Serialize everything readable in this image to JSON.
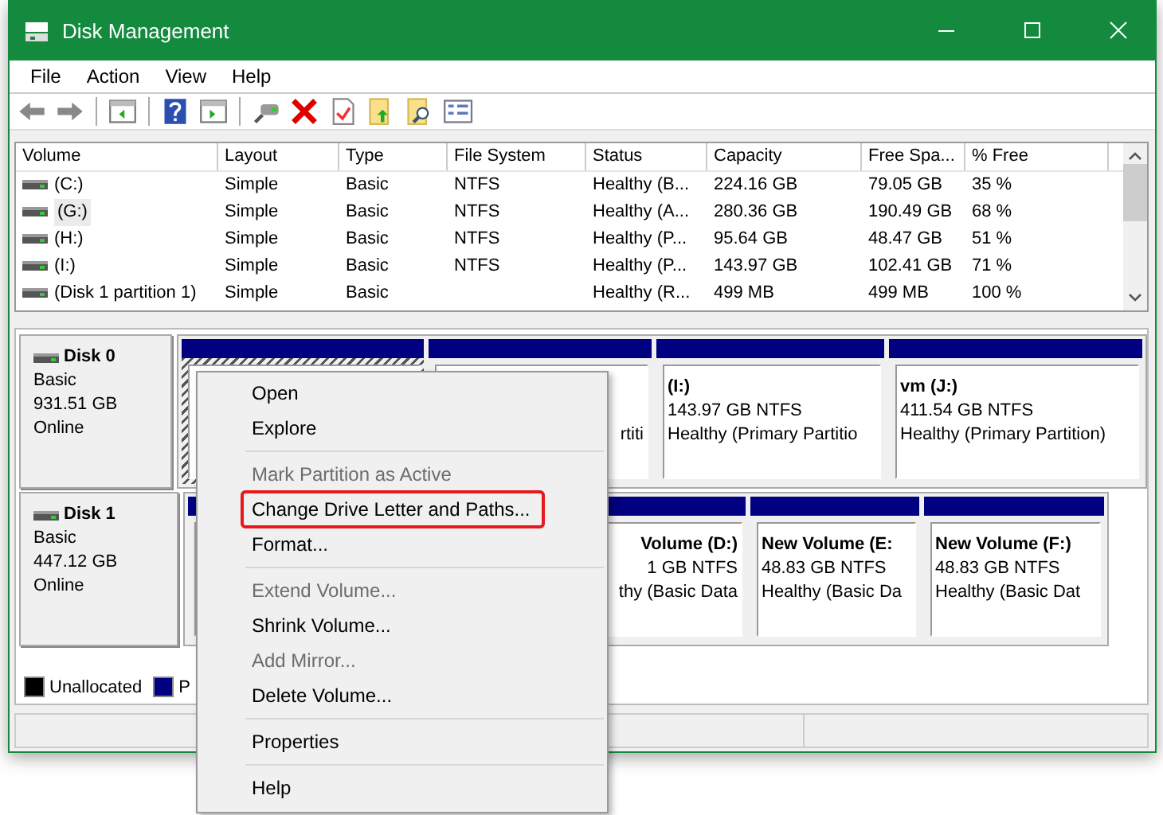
{
  "window": {
    "title": "Disk Management"
  },
  "menu_bar": [
    "File",
    "Action",
    "View",
    "Help"
  ],
  "table": {
    "columns": [
      "Volume",
      "Layout",
      "Type",
      "File System",
      "Status",
      "Capacity",
      "Free Spa...",
      "% Free"
    ],
    "rows": [
      {
        "cells": [
          "(C:)",
          "Simple",
          "Basic",
          "NTFS",
          "Healthy (B...",
          "224.16 GB",
          "79.05 GB",
          "35 %"
        ],
        "selected": false
      },
      {
        "cells": [
          "(G:)",
          "Simple",
          "Basic",
          "NTFS",
          "Healthy (A...",
          "280.36 GB",
          "190.49 GB",
          "68 %"
        ],
        "selected": true
      },
      {
        "cells": [
          "(H:)",
          "Simple",
          "Basic",
          "NTFS",
          "Healthy (P...",
          "95.64 GB",
          "48.47 GB",
          "51 %"
        ],
        "selected": false
      },
      {
        "cells": [
          "(I:)",
          "Simple",
          "Basic",
          "NTFS",
          "Healthy (P...",
          "143.97 GB",
          "102.41 GB",
          "71 %"
        ],
        "selected": false
      },
      {
        "cells": [
          "(Disk 1 partition 1)",
          "Simple",
          "Basic",
          "",
          "Healthy (R...",
          "499 MB",
          "499 MB",
          "100 %"
        ],
        "selected": false
      }
    ]
  },
  "disks": [
    {
      "name": "Disk 0",
      "type": "Basic",
      "size": "931.51 GB",
      "status": "Online",
      "partitions": [
        {
          "kind": "head",
          "selected": true
        },
        {
          "kind": "tail",
          "status": "rtiti",
          "selected": false
        },
        {
          "kind": "full",
          "name": "(I:)",
          "size": "143.97 GB NTFS",
          "status": "Healthy (Primary Partitio",
          "selected": false
        },
        {
          "kind": "full",
          "name": "vm  (J:)",
          "size": "411.54 GB NTFS",
          "status": "Healthy (Primary Partition)",
          "selected": false
        }
      ]
    },
    {
      "name": "Disk 1",
      "type": "Basic",
      "size": "447.12 GB",
      "status": "Online",
      "partitions": [
        {
          "kind": "head",
          "selected": false
        },
        {
          "kind": "tail",
          "name": "Volume  (D:)",
          "size": "1 GB NTFS",
          "status": "thy (Basic Data",
          "selected": false
        },
        {
          "kind": "full",
          "name": "New Volume  (E:",
          "size": "48.83 GB NTFS",
          "status": "Healthy (Basic Da",
          "selected": false
        },
        {
          "kind": "full",
          "name": "New Volume  (F:)",
          "size": "48.83 GB NTFS",
          "status": "Healthy (Basic Dat",
          "selected": false
        }
      ]
    }
  ],
  "legend": [
    {
      "label": "Unallocated",
      "color": "#000000"
    },
    {
      "label": "P",
      "color": "#000080"
    }
  ],
  "context_menu": [
    {
      "kind": "item",
      "label": "Open",
      "disabled": false,
      "highlighted": false
    },
    {
      "kind": "item",
      "label": "Explore",
      "disabled": false,
      "highlighted": false
    },
    {
      "kind": "separator"
    },
    {
      "kind": "item",
      "label": "Mark Partition as Active",
      "disabled": true,
      "highlighted": false
    },
    {
      "kind": "item",
      "label": "Change Drive Letter and Paths...",
      "disabled": false,
      "highlighted": true
    },
    {
      "kind": "item",
      "label": "Format...",
      "disabled": false,
      "highlighted": false
    },
    {
      "kind": "separator"
    },
    {
      "kind": "item",
      "label": "Extend Volume...",
      "disabled": true,
      "highlighted": false
    },
    {
      "kind": "item",
      "label": "Shrink Volume...",
      "disabled": false,
      "highlighted": false
    },
    {
      "kind": "item",
      "label": "Add Mirror...",
      "disabled": true,
      "highlighted": false
    },
    {
      "kind": "item",
      "label": "Delete Volume...",
      "disabled": false,
      "highlighted": false
    },
    {
      "kind": "separator"
    },
    {
      "kind": "item",
      "label": "Properties",
      "disabled": false,
      "highlighted": false
    },
    {
      "kind": "separator"
    },
    {
      "kind": "item",
      "label": "Help",
      "disabled": false,
      "highlighted": false
    }
  ]
}
